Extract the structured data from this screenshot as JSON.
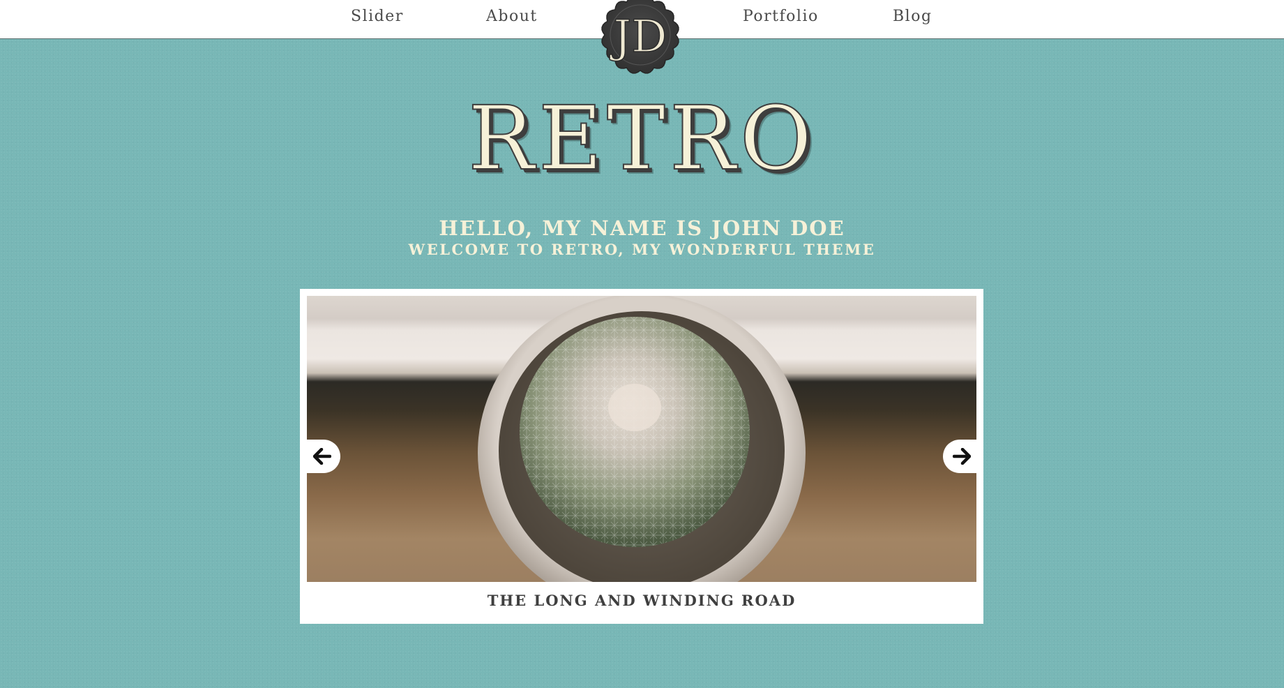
{
  "nav": {
    "items": [
      {
        "label": "Slider"
      },
      {
        "label": "About"
      },
      {
        "label": "Portfolio"
      },
      {
        "label": "Blog"
      }
    ],
    "logo_initials": "JD"
  },
  "hero": {
    "title": "RETRO",
    "greeting": "HELLO, MY NAME IS JOHN DOE",
    "subtitle": "WELCOME TO RETRO, MY WONDERFUL THEME"
  },
  "slider": {
    "caption": "THE LONG AND WINDING ROAD",
    "image_subject": "cactus-in-pot-photo",
    "prev_icon": "arrow-left-icon",
    "next_icon": "arrow-right-icon"
  },
  "colors": {
    "background": "#78b7b6",
    "cream": "#f6f1d8",
    "dark": "#3e3e3e",
    "nav_text": "#4a4a4a"
  }
}
